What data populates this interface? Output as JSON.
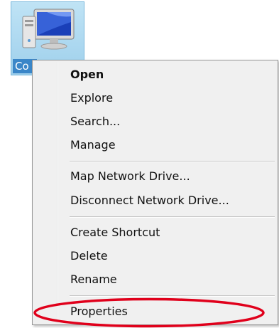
{
  "desktop_icon": {
    "label": "Co",
    "icon": "computer-icon"
  },
  "context_menu": {
    "items": [
      {
        "label": "Open",
        "bold": true
      },
      {
        "label": "Explore"
      },
      {
        "label": "Search..."
      },
      {
        "label": "Manage"
      },
      {
        "label": "Map Network Drive..."
      },
      {
        "label": "Disconnect Network Drive..."
      },
      {
        "label": "Create Shortcut"
      },
      {
        "label": "Delete"
      },
      {
        "label": "Rename"
      },
      {
        "label": "Properties"
      }
    ]
  },
  "colors": {
    "menu_background": "#f0f0f0",
    "highlight_ellipse": "#e0001b",
    "icon_selection": "#9fd0ec",
    "label_selection": "#3a86c8"
  }
}
